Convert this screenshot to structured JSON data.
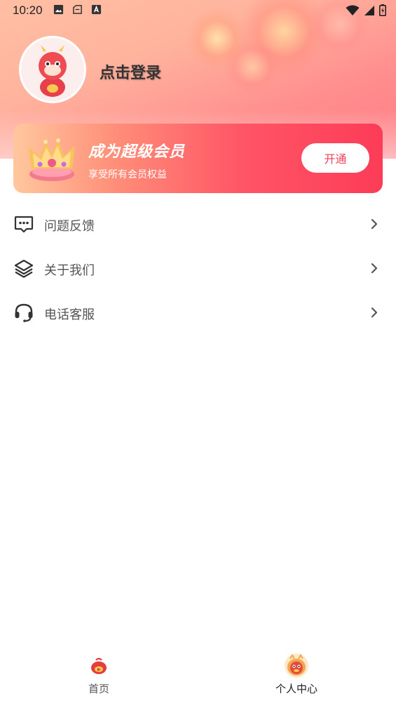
{
  "status_bar": {
    "time": "10:20"
  },
  "profile": {
    "login_text": "点击登录"
  },
  "vip": {
    "title": "成为超级会员",
    "subtitle": "享受所有会员权益",
    "button": "开通"
  },
  "menu": [
    {
      "label": "问题反馈",
      "icon": "feedback-chat-icon"
    },
    {
      "label": "关于我们",
      "icon": "layers-icon"
    },
    {
      "label": "电话客服",
      "icon": "headset-icon"
    }
  ],
  "tabs": [
    {
      "label": "首页",
      "icon": "home-mascot-icon",
      "active": false
    },
    {
      "label": "个人中心",
      "icon": "profile-mascot-icon",
      "active": true
    }
  ],
  "colors": {
    "accent": "#f0405a",
    "menu_text": "#555555",
    "tab_inactive": "#555555",
    "tab_active": "#222222"
  }
}
